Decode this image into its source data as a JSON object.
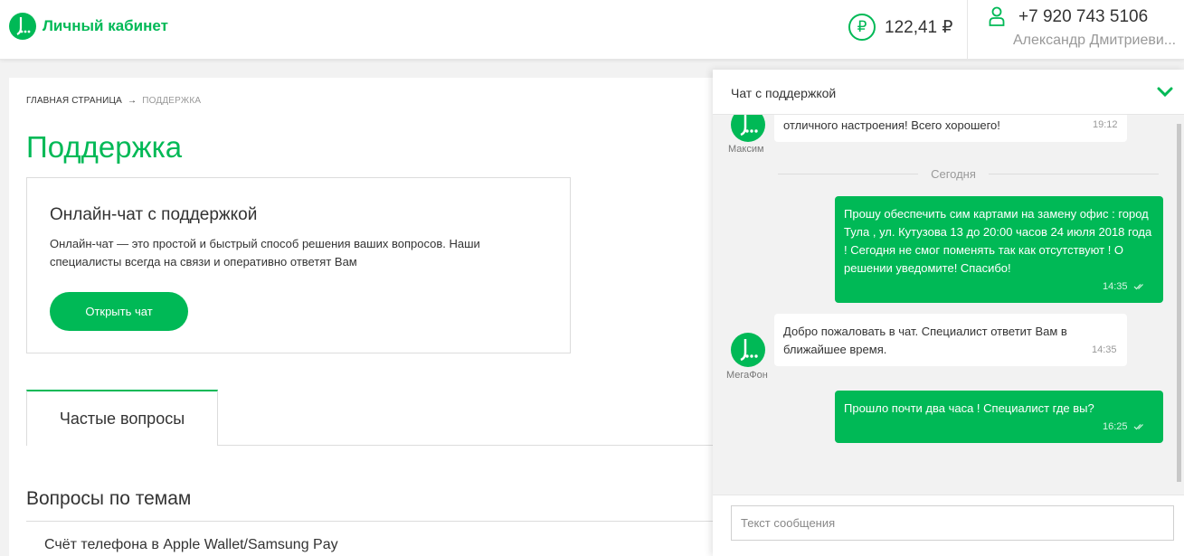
{
  "header": {
    "logo_text": "Личный кабинет",
    "balance": "122,41 ₽",
    "ruble_symbol": "₽",
    "phone": "+7 920 743 5106",
    "user_name": "Александр Дмитриеви..."
  },
  "main": {
    "breadcrumb": [
      "ГЛАВНАЯ СТРАНИЦА",
      "→",
      "ПОДДЕРЖКА"
    ],
    "page_title": "Поддержка",
    "chat_box": {
      "title": "Онлайн-чат с поддержкой",
      "description": "Онлайн-чат — это простой и быстрый способ решения ваших вопросов. Наши специалисты всегда на связи и оперативно ответят Вам",
      "button_label": "Открыть чат"
    },
    "tab_label": "Частые вопросы",
    "section_title": "Вопросы по темам",
    "faq_item": "Счёт телефона в Apple Wallet/Samsung Pay"
  },
  "chat": {
    "title": "Чат с поддержкой",
    "day_separator": "Сегодня",
    "input_placeholder": "Текст сообщения",
    "messages": [
      {
        "sender": "Максим",
        "text": "отличного настроения! Всего хорошего!",
        "time": "19:12"
      },
      {
        "sender": "me",
        "text": "Прошу обеспечить сим картами на замену офис : город Тула , ул. Кутузова 13 до 20:00 часов 24 июля 2018 года ! Сегодня не смог поменять так как отсутствуют ! О решении уведомите! Спасибо!",
        "time": "14:35"
      },
      {
        "sender": "МегаФон",
        "text": "Добро пожаловать в чат. Специалист ответит Вам в ближайшее время.",
        "time": "14:35"
      },
      {
        "sender": "me",
        "text": "Прошло почти два часа ! Специалист где вы?",
        "time": "16:25"
      }
    ]
  },
  "colors": {
    "brand_green": "#00b956",
    "text": "#333333",
    "muted": "#999999",
    "background": "#f2f2f2"
  }
}
